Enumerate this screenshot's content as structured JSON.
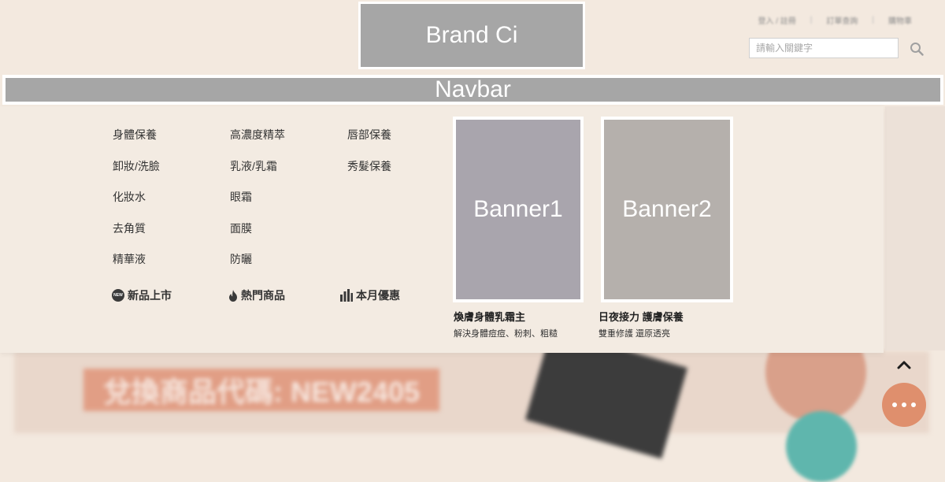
{
  "header": {
    "brand_placeholder": "Brand Ci",
    "util_links": [
      "登入 / 註冊",
      "訂單查詢",
      "購物車"
    ],
    "search": {
      "placeholder": "請輸入關鍵字"
    }
  },
  "navbar": {
    "placeholder": "Navbar"
  },
  "mega_menu": {
    "columns": [
      [
        "身體保養",
        "卸妝/洗臉",
        "化妝水",
        "去角質",
        "精華液"
      ],
      [
        "高濃度精萃",
        "乳液/乳霜",
        "眼霜",
        "面膜",
        "防曬"
      ],
      [
        "唇部保養",
        "秀髮保養"
      ]
    ],
    "specials": [
      {
        "label": "新品上市",
        "icon": "new-badge-icon",
        "badge_text": "NEW"
      },
      {
        "label": "熱門商品",
        "icon": "fire-icon"
      },
      {
        "label": "本月優惠",
        "icon": "bar-chart-icon"
      }
    ],
    "banners": [
      {
        "placeholder": "Banner1",
        "title": "煥膚身體乳霜主",
        "subtitle": "解決身體痘痘、粉刺、粗糙"
      },
      {
        "placeholder": "Banner2",
        "title": "日夜接力 護膚保養",
        "subtitle": "雙重修護 還原透亮"
      }
    ]
  },
  "background": {
    "promo_text": "兌換商品代碼: NEW2405"
  },
  "colors": {
    "page_bg": "#f3e9df",
    "placeholder_gray": "#a6a6a6",
    "chat_button": "#df8f6d"
  },
  "fixed_buttons": {
    "back_to_top_icon": "chevron-up-icon",
    "chat_icon": "chat-dots-icon"
  }
}
